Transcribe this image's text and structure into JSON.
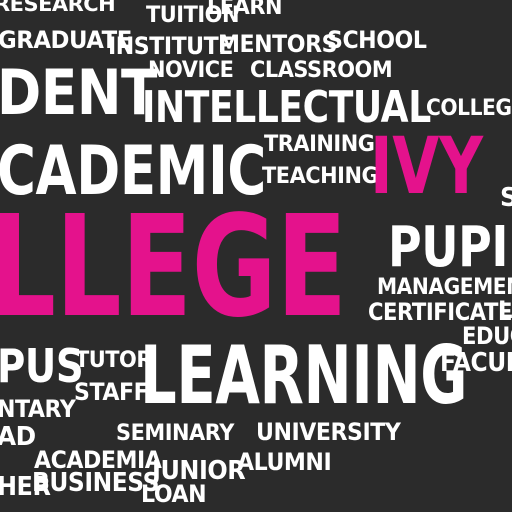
{
  "colors": {
    "background": "#2b2b2b",
    "text": "#ffffff",
    "accent": "#e4128c"
  },
  "words": [
    {
      "id": "research",
      "text": "RESEARCH",
      "color": "white"
    },
    {
      "id": "tuition",
      "text": "TUITION",
      "color": "white"
    },
    {
      "id": "learn",
      "text": "LEARN",
      "color": "white"
    },
    {
      "id": "graduate",
      "text": "GRADUATE",
      "color": "white"
    },
    {
      "id": "institute",
      "text": "INSTITUTE",
      "color": "white"
    },
    {
      "id": "mentors",
      "text": "MENTORS",
      "color": "white"
    },
    {
      "id": "school",
      "text": "SCHOOL",
      "color": "white"
    },
    {
      "id": "dent",
      "text": "DENT",
      "color": "white"
    },
    {
      "id": "novice",
      "text": "NOVICE",
      "color": "white"
    },
    {
      "id": "classroom",
      "text": "CLASSROOM",
      "color": "white"
    },
    {
      "id": "intellectual",
      "text": "INTELLECTUAL",
      "color": "white"
    },
    {
      "id": "collegia",
      "text": "COLLEGIA",
      "color": "white"
    },
    {
      "id": "training",
      "text": "TRAINING",
      "color": "white"
    },
    {
      "id": "academic",
      "text": "CADEMIC",
      "color": "white"
    },
    {
      "id": "teaching",
      "text": "TEACHING",
      "color": "white"
    },
    {
      "id": "ivy",
      "text": "IVY",
      "color": "pink"
    },
    {
      "id": "s",
      "text": "S",
      "color": "white"
    },
    {
      "id": "college",
      "text": "LLEGE",
      "color": "pink"
    },
    {
      "id": "pupil",
      "text": "PUPIL",
      "color": "white"
    },
    {
      "id": "management",
      "text": "MANAGEMENT",
      "color": "white"
    },
    {
      "id": "certificate",
      "text": "CERTIFICATE",
      "color": "white"
    },
    {
      "id": "l",
      "text": "L",
      "color": "white"
    },
    {
      "id": "educ",
      "text": "EDUC",
      "color": "white"
    },
    {
      "id": "campus",
      "text": "PUS",
      "color": "white"
    },
    {
      "id": "tutor",
      "text": "TUTOR",
      "color": "white"
    },
    {
      "id": "learning",
      "text": "LEARNING",
      "color": "white"
    },
    {
      "id": "facult",
      "text": "FACULT",
      "color": "white"
    },
    {
      "id": "staff",
      "text": "STAFF",
      "color": "white"
    },
    {
      "id": "elementary",
      "text": "NTARY",
      "color": "white"
    },
    {
      "id": "ad",
      "text": "AD",
      "color": "white"
    },
    {
      "id": "seminary",
      "text": "SEMINARY",
      "color": "white"
    },
    {
      "id": "university",
      "text": "UNIVERSITY",
      "color": "white"
    },
    {
      "id": "academia",
      "text": "ACADEMIA",
      "color": "white"
    },
    {
      "id": "junior",
      "text": "JUNIOR",
      "color": "white"
    },
    {
      "id": "alumni",
      "text": "ALUMNI",
      "color": "white"
    },
    {
      "id": "her",
      "text": "HER",
      "color": "white"
    },
    {
      "id": "business",
      "text": "BUSINESS",
      "color": "white"
    },
    {
      "id": "loan",
      "text": "LOAN",
      "color": "white"
    }
  ]
}
